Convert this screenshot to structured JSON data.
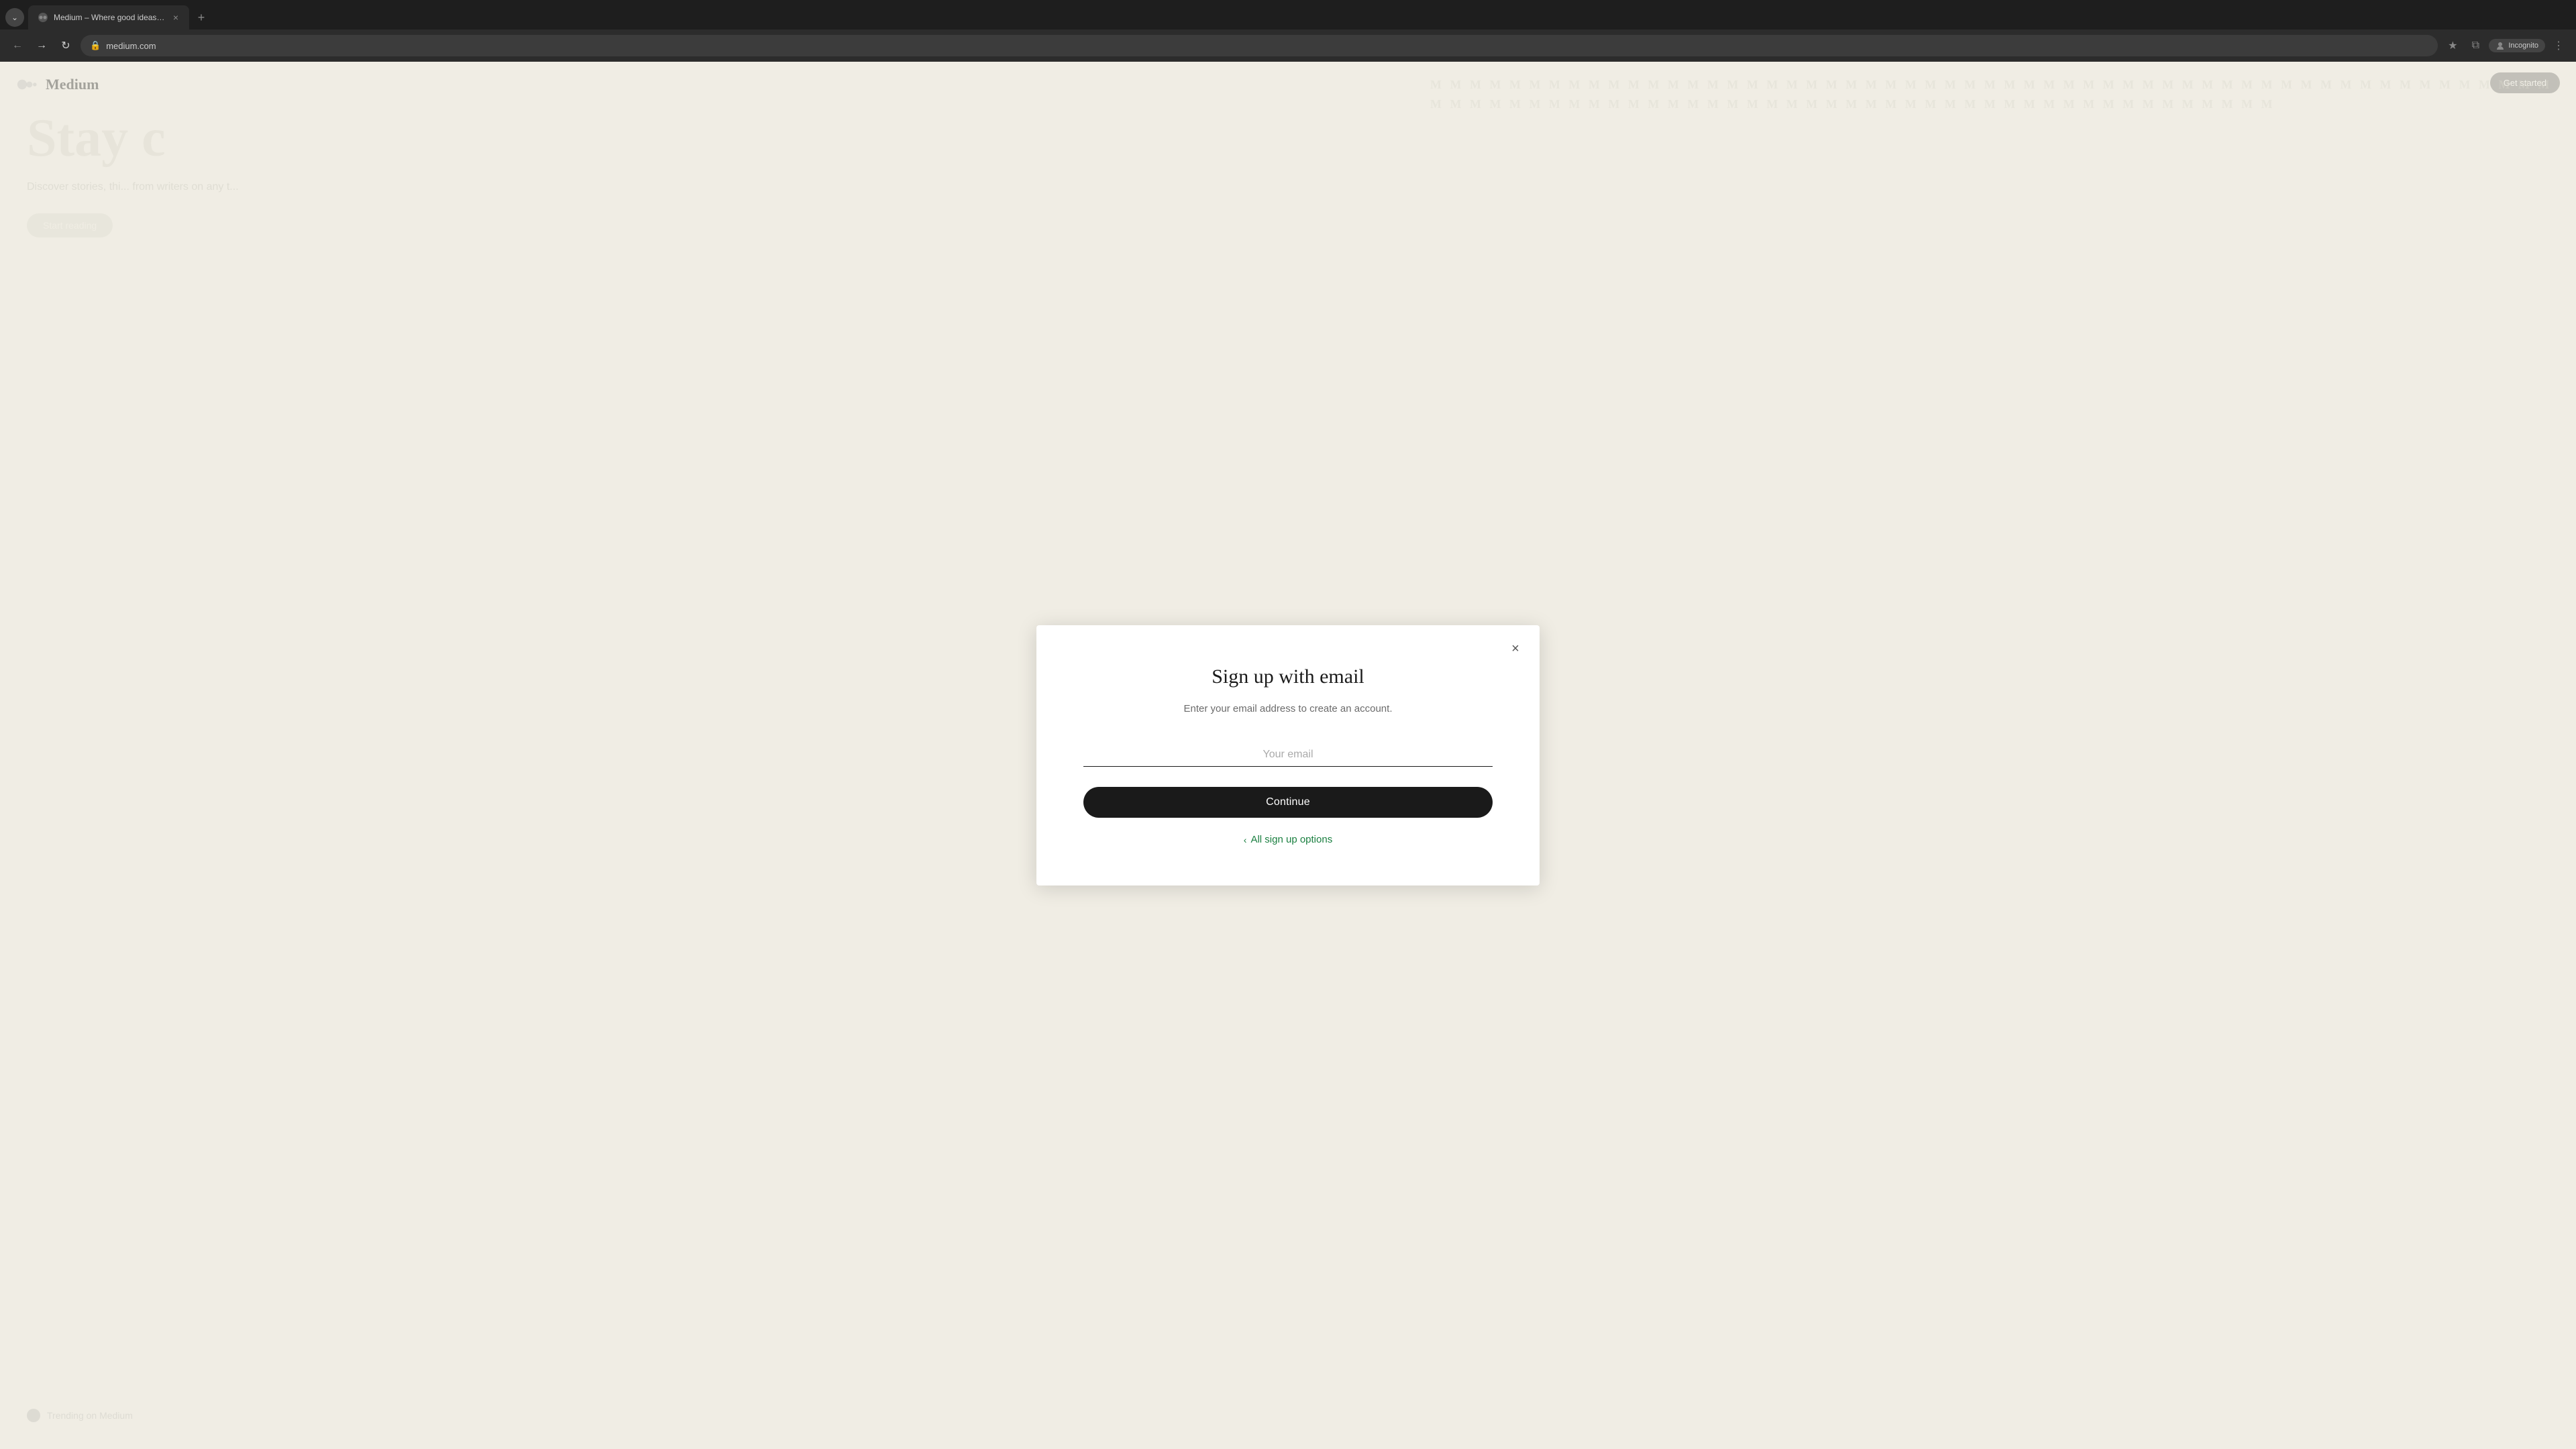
{
  "browser": {
    "tab": {
      "favicon": "medium-favicon",
      "title": "Medium – Where good ideas fi...",
      "close_label": "×"
    },
    "new_tab_label": "+",
    "back_btn": "←",
    "forward_btn": "→",
    "refresh_btn": "↻",
    "address": "medium.com",
    "bookmark_icon": "★",
    "split_icon": "⧉",
    "incognito_label": "Incognito",
    "more_icon": "⋮",
    "tab_list_icon": "⌄"
  },
  "background": {
    "logo_text": "Medium",
    "hero_text": "Stay c",
    "subtitle": "Discover stories, thi... from writers on any t...",
    "start_reading": "Start reading",
    "trending_label": "Trending on Medium",
    "top_right_btn": "Get started",
    "m_pattern": "M M M M M M M M M M M M M M M M M M M M M M M M M M M M M M M M M M M M M M M M M M M M M M M M M M M M M M M M M M M M M M M M M M M M M M M M M M M M M M M M M M M M M M M M M M M M M M M M M M M M"
  },
  "modal": {
    "title": "Sign up with email",
    "subtitle": "Enter your email address to create an account.",
    "email_label": "Your email",
    "email_placeholder": "Your email",
    "continue_label": "Continue",
    "all_signup_label": "All sign up options",
    "close_label": "×"
  }
}
